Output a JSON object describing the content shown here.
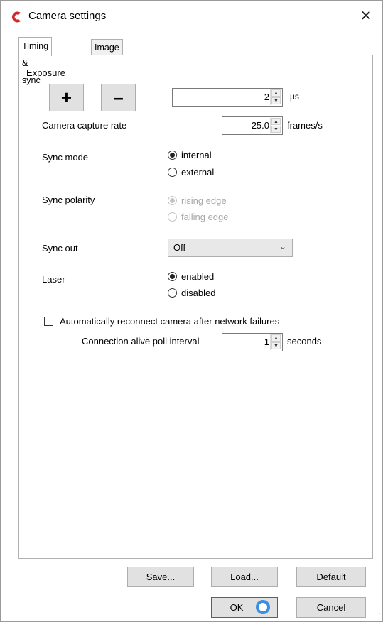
{
  "window": {
    "title": "Camera settings",
    "close_glyph": "✕",
    "icon": "app-logo-icon",
    "accent": "#d0262e"
  },
  "tabs": [
    {
      "label": "Timing & sync",
      "active": true
    },
    {
      "label": "Image",
      "active": false
    }
  ],
  "exposure": {
    "label": "Exposure",
    "plus": "+",
    "minus": "–",
    "value": "2",
    "unit": "µs"
  },
  "capture_rate": {
    "label": "Camera capture rate",
    "value": "25.0",
    "unit": "frames/s"
  },
  "sync_mode": {
    "label": "Sync mode",
    "options": [
      {
        "label": "internal",
        "selected": true
      },
      {
        "label": "external",
        "selected": false
      }
    ]
  },
  "sync_polarity": {
    "label": "Sync polarity",
    "disabled": true,
    "options": [
      {
        "label": "rising edge",
        "selected": true
      },
      {
        "label": "falling edge",
        "selected": false
      }
    ]
  },
  "sync_out": {
    "label": "Sync out",
    "value": "Off"
  },
  "laser": {
    "label": "Laser",
    "options": [
      {
        "label": "enabled",
        "selected": true
      },
      {
        "label": "disabled",
        "selected": false
      }
    ]
  },
  "reconnect": {
    "label": "Automatically reconnect camera after network failures",
    "checked": false
  },
  "poll": {
    "label": "Connection alive poll interval",
    "value": "1",
    "unit": "seconds"
  },
  "buttons": {
    "save": "Save...",
    "load": "Load...",
    "default": "Default",
    "ok": "OK",
    "cancel": "Cancel"
  }
}
